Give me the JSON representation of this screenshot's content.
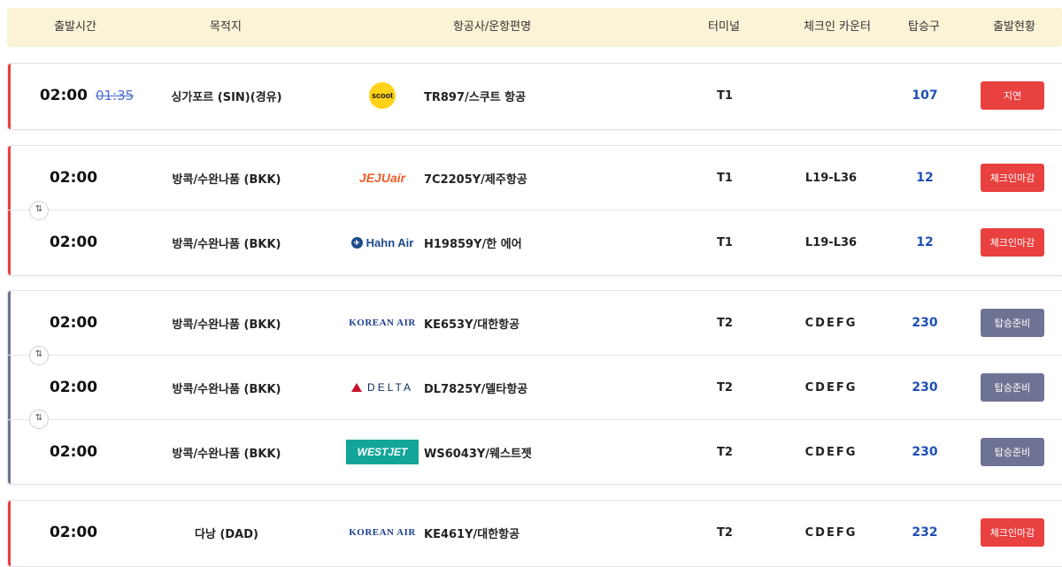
{
  "header": {
    "departure_time": "출발시간",
    "destination": "목적지",
    "airline_flight": "항공사/운항편명",
    "terminal": "터미널",
    "checkin_counter": "체크인 카운터",
    "gate": "탑승구",
    "status": "출발현황"
  },
  "colors": {
    "delayed": "#e8413f",
    "checkin_closed": "#e8413f",
    "boarding_ready": "#6f7393",
    "group_red_bar": "#e8413f",
    "group_gray_bar": "#6f7393",
    "header_bg": "#fbf3d6",
    "gate_text": "#1e4fb4"
  },
  "groups": [
    {
      "flights": [
        {
          "time": "02:00",
          "original_time": "01:35",
          "destination": "싱가포르 (SIN)(경유)",
          "logo": "scoot",
          "logo_text": "scoot",
          "flight": "TR897/스쿠트 항공",
          "terminal": "T1",
          "counter": "",
          "gate": "107",
          "status": "지연"
        }
      ]
    },
    {
      "swap_icon": "swap-icon",
      "flights": [
        {
          "time": "02:00",
          "destination": "방콕/수완나품 (BKK)",
          "logo": "jejuair",
          "logo_text": "JEJUair",
          "flight": "7C2205Y/제주항공",
          "terminal": "T1",
          "counter": "L19-L36",
          "gate": "12",
          "status": "체크인마감"
        },
        {
          "time": "02:00",
          "destination": "방콕/수완나품 (BKK)",
          "logo": "hahnair",
          "logo_text": "Hahn Air",
          "flight": "H19859Y/한 에어",
          "terminal": "T1",
          "counter": "L19-L36",
          "gate": "12",
          "status": "체크인마감"
        }
      ]
    },
    {
      "flights": [
        {
          "time": "02:00",
          "destination": "방콕/수완나품 (BKK)",
          "logo": "koreanair",
          "logo_text": "KOREAN AIR",
          "flight": "KE653Y/대한항공",
          "terminal": "T2",
          "counter": "CDEFG",
          "gate": "230",
          "status": "탑승준비"
        },
        {
          "time": "02:00",
          "destination": "방콕/수완나품 (BKK)",
          "logo": "delta",
          "logo_text": "DELTA",
          "flight": "DL7825Y/델타항공",
          "terminal": "T2",
          "counter": "CDEFG",
          "gate": "230",
          "status": "탑승준비"
        },
        {
          "time": "02:00",
          "destination": "방콕/수완나품 (BKK)",
          "logo": "westjet",
          "logo_text": "WESTJET",
          "flight": "WS6043Y/웨스트젯",
          "terminal": "T2",
          "counter": "CDEFG",
          "gate": "230",
          "status": "탑승준비"
        }
      ]
    },
    {
      "flights": [
        {
          "time": "02:00",
          "destination": "다낭 (DAD)",
          "logo": "koreanair",
          "logo_text": "KOREAN AIR",
          "flight": "KE461Y/대한항공",
          "terminal": "T2",
          "counter": "CDEFG",
          "gate": "232",
          "status": "체크인마감"
        }
      ]
    }
  ]
}
